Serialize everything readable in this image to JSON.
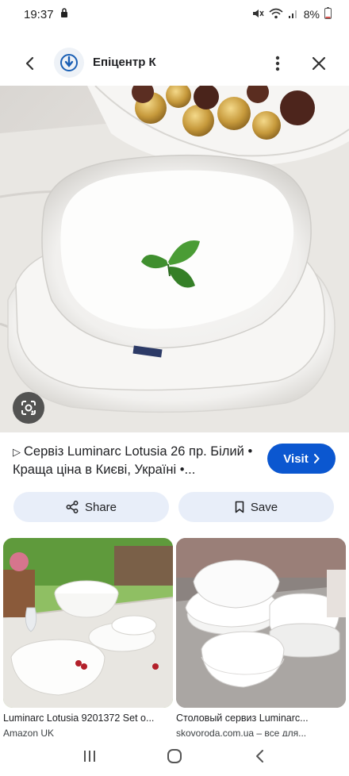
{
  "status_bar": {
    "time": "19:37",
    "battery_percent": "8%"
  },
  "header": {
    "site_name": "Епіцентр К"
  },
  "result": {
    "title": "Сервіз Luminarc Lotusia 26 пр. Білий • Краща ціна в Києві, Україні •...",
    "visit_label": "Visit"
  },
  "actions": {
    "share_label": "Share",
    "save_label": "Save"
  },
  "related": [
    {
      "title": "Luminarc Lotusia 9201372 Set o...",
      "source": "Amazon UK"
    },
    {
      "title": "Столовый сервиз Luminarc...",
      "source": "skovoroda.com.ua – все для..."
    }
  ],
  "colors": {
    "accent": "#0b57d0",
    "chip_bg": "#e8eef9"
  },
  "icons": [
    "back-arrow-icon",
    "epicentr-logo-icon",
    "more-vert-icon",
    "close-icon",
    "lens-icon",
    "play-icon",
    "chevron-right-icon",
    "share-icon",
    "bookmark-icon",
    "recents-icon",
    "home-icon",
    "back-icon"
  ]
}
